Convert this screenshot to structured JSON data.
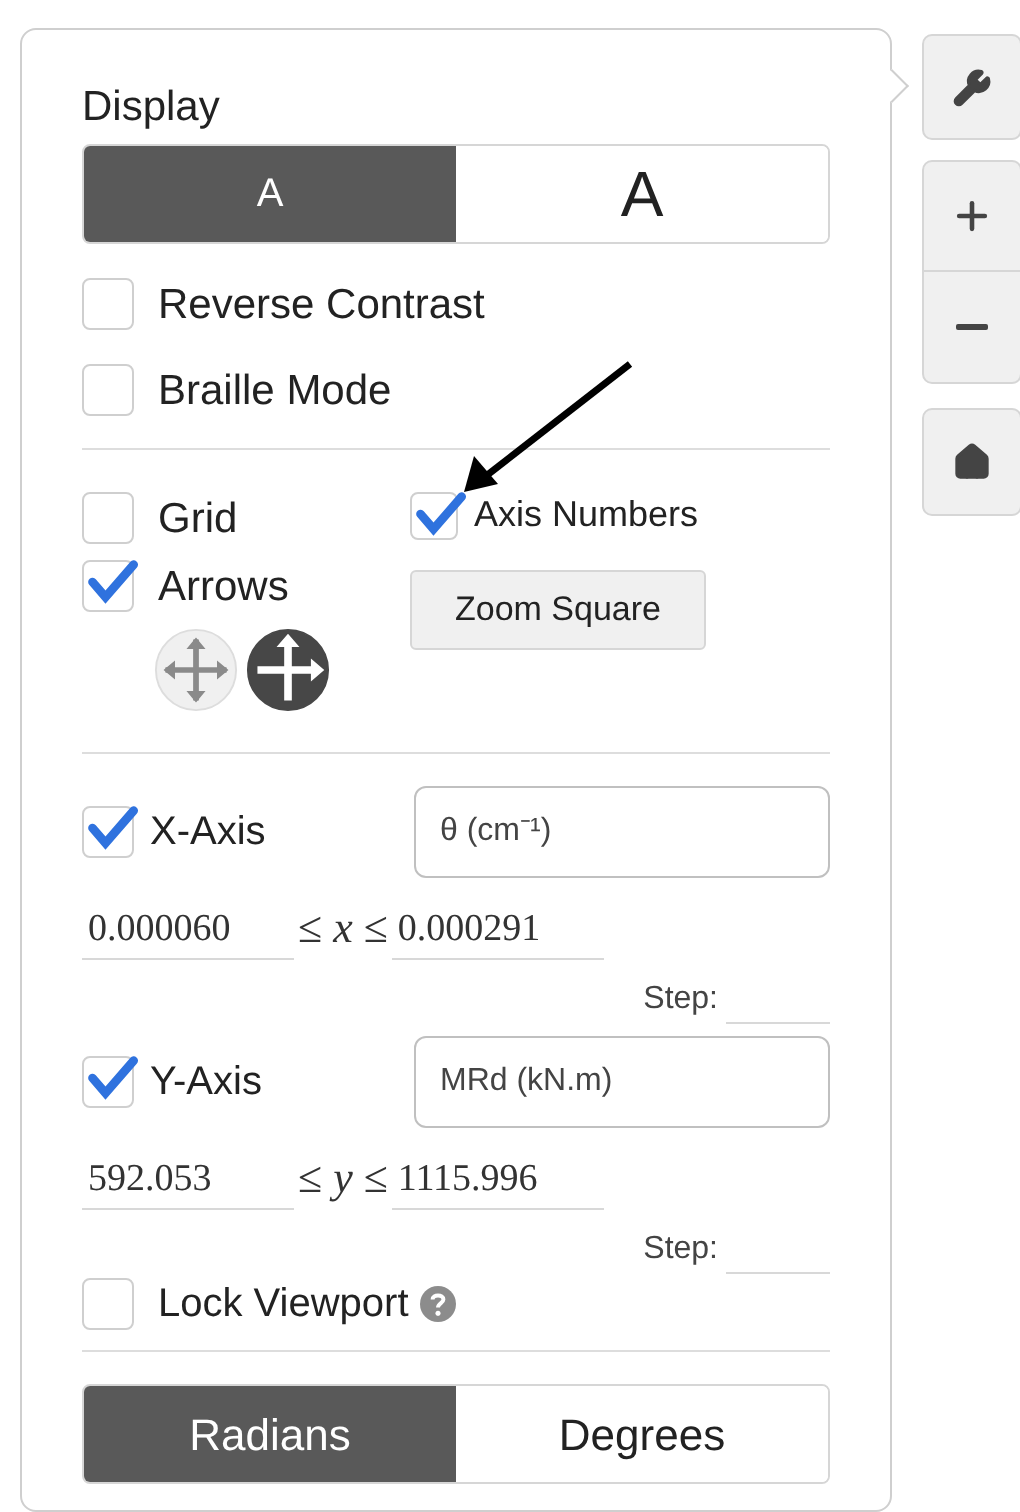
{
  "display": {
    "title": "Display",
    "text_size": [
      {
        "label": "A",
        "selected": true
      },
      {
        "label": "A",
        "selected": false
      }
    ]
  },
  "options": [
    {
      "label": "Reverse Contrast",
      "checked": false
    },
    {
      "label": "Braille Mode",
      "checked": false
    }
  ],
  "grid": {
    "label": "Grid",
    "checked": false
  },
  "axis_numbers": {
    "label": "Axis Numbers",
    "checked": true
  },
  "arrows": {
    "label": "Arrows",
    "checked": true,
    "styles": [
      {
        "selected": false
      },
      {
        "selected": true
      }
    ]
  },
  "zoom_square": "Zoom Square",
  "axes": [
    {
      "label": "X-Axis",
      "checked": true,
      "axis_label": "θ (cm⁻¹)",
      "min": "0.000060",
      "relation": "≤ *x* ≤",
      "max": "0.000291",
      "step_label": "Step:"
    },
    {
      "label": "Y-Axis",
      "checked": true,
      "axis_label": "MRd (kN.m)",
      "min": "592.053",
      "relation": "≤ *y* ≤",
      "max": "1115.996",
      "step_label": "Step:"
    }
  ],
  "lock_viewport": {
    "label": "Lock Viewport",
    "checked": false
  },
  "angle_units": [
    {
      "label": "Radians",
      "selected": true
    },
    {
      "label": "Degrees",
      "selected": false
    }
  ]
}
